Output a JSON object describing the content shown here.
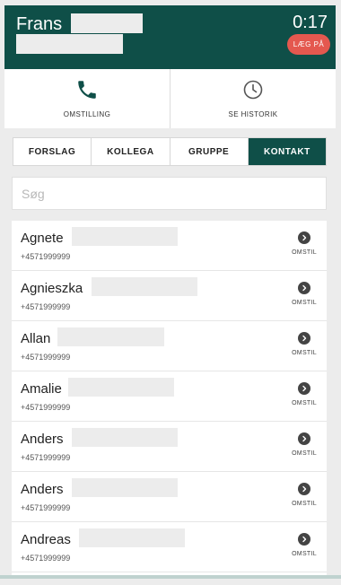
{
  "call": {
    "caller_name": "Frans",
    "timer": "0:17",
    "hangup_label": "LÆG PÅ"
  },
  "actions": {
    "transfer_label": "OMSTILLING",
    "history_label": "SE HISTORIK"
  },
  "tabs": [
    {
      "label": "FORSLAG",
      "active": false
    },
    {
      "label": "KOLLEGA",
      "active": false
    },
    {
      "label": "GRUPPE",
      "active": false
    },
    {
      "label": "KONTAKT",
      "active": true
    }
  ],
  "search": {
    "placeholder": "Søg",
    "value": ""
  },
  "contacts": [
    {
      "name": "Agnete",
      "phone": "+4571999999",
      "action_label": "OMSTIL"
    },
    {
      "name": "Agnieszka",
      "phone": "+4571999999",
      "action_label": "OMSTIL"
    },
    {
      "name": "Allan",
      "phone": "+4571999999",
      "action_label": "OMSTIL"
    },
    {
      "name": "Amalie",
      "phone": "+4571999999",
      "action_label": "OMSTIL"
    },
    {
      "name": "Anders",
      "phone": "+4571999999",
      "action_label": "OMSTIL"
    },
    {
      "name": "Anders",
      "phone": "+4571999999",
      "action_label": "OMSTIL"
    },
    {
      "name": "Andreas",
      "phone": "+4571999999",
      "action_label": "OMSTIL"
    }
  ],
  "icons": {
    "transfer": "phone-icon",
    "history": "clock-icon",
    "row_action": "chevron-right-circle-icon"
  },
  "colors": {
    "brand": "#0f4f48",
    "hangup": "#e4584f",
    "background": "#ececec"
  }
}
